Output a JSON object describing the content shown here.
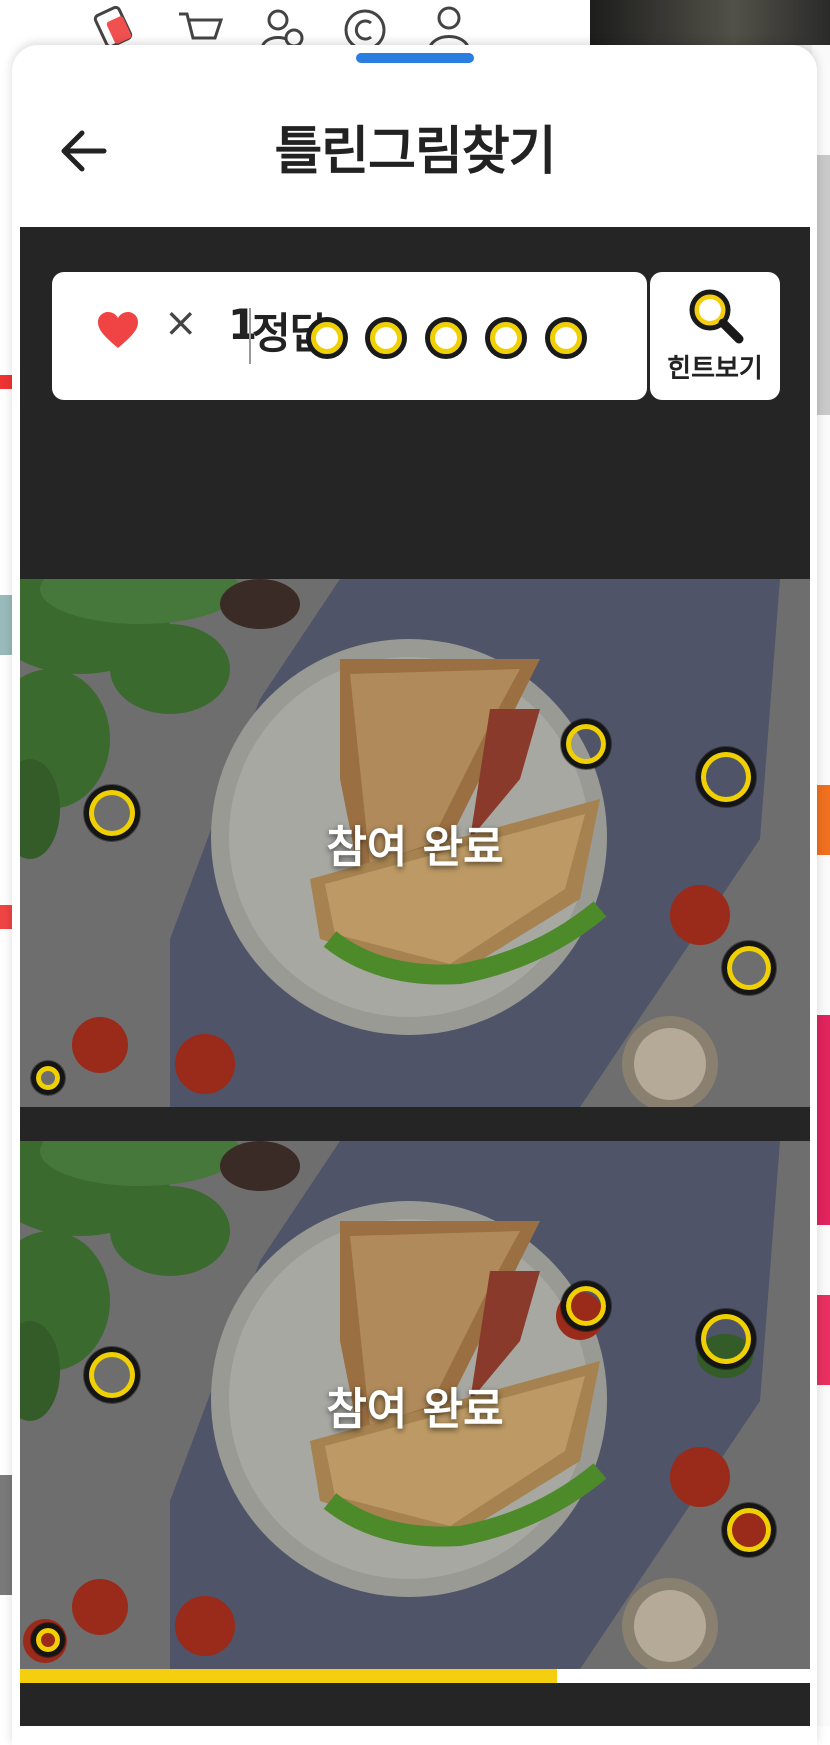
{
  "header": {
    "title": "틀린그림찾기"
  },
  "status": {
    "times_symbol": "×",
    "lives": "1",
    "answer_label": "정답",
    "answer_slots_total": 5,
    "answer_slots_found": 0
  },
  "hint": {
    "label": "힌트보기"
  },
  "pictures": {
    "top": {
      "overlay_label": "참여 완료"
    },
    "bottom": {
      "overlay_label": "참여 완료"
    }
  },
  "progress": {
    "fraction": 0.68
  },
  "colors": {
    "accent": "#f5cf0f",
    "marker_ring": "#f0d000",
    "heart": "#f04444",
    "game_background": "#252525",
    "handle": "#2a7de1"
  },
  "icons": {
    "back": "arrow-left-icon",
    "heart": "heart-icon",
    "hint": "magnifier-icon"
  }
}
